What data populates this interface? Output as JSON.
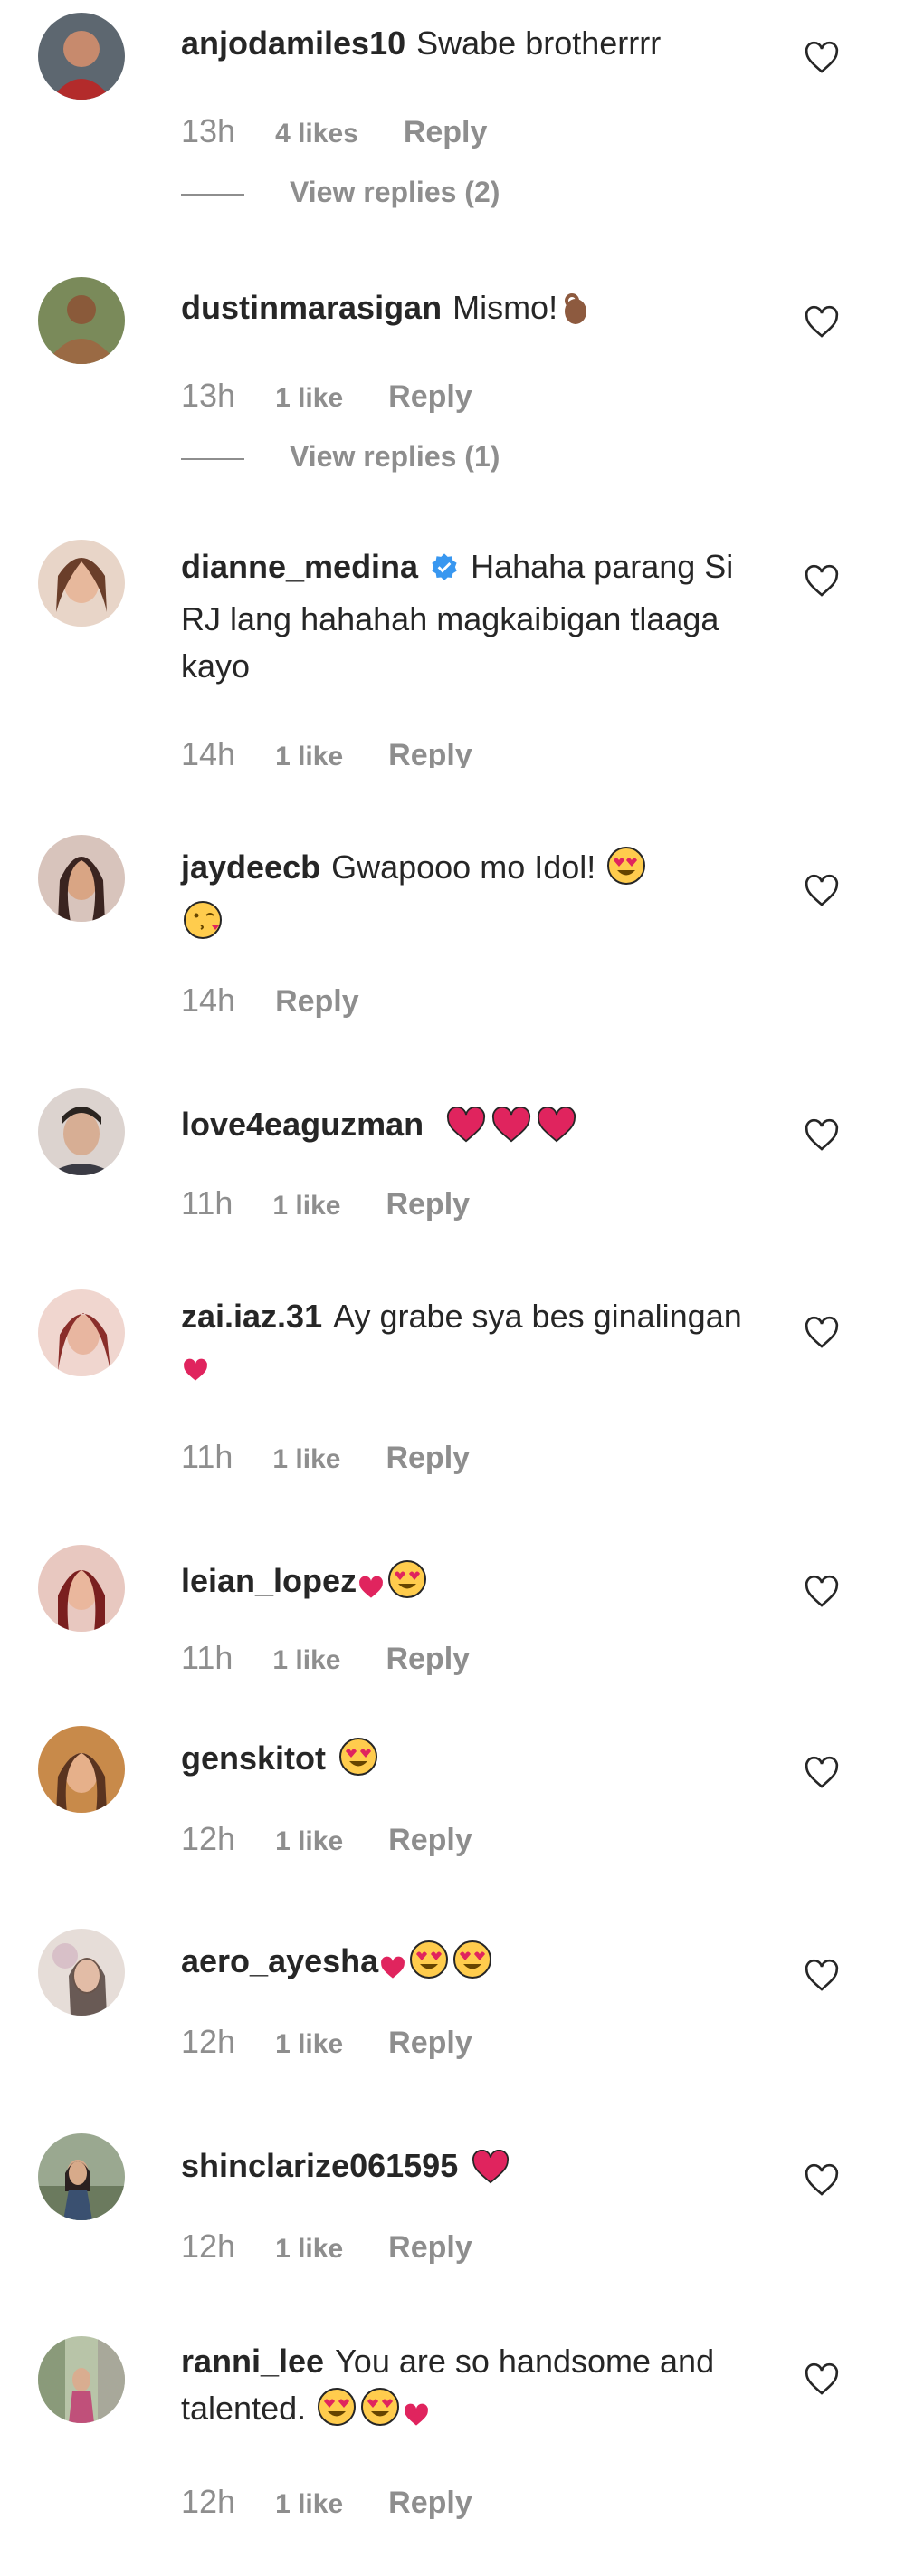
{
  "comments": [
    {
      "username": "anjodamiles10",
      "text": "Swabe brotherrrr",
      "emojis": [],
      "time": "13h",
      "likes": "4 likes",
      "reply_label": "Reply",
      "view_replies": "View replies (2)",
      "avatar_color": "#7a3b3b"
    },
    {
      "username": "dustinmarasigan",
      "text": "Mismo!",
      "emojis": [
        "ok-hand-emoji"
      ],
      "time": "13h",
      "likes": "1 like",
      "reply_label": "Reply",
      "view_replies": "View replies (1)",
      "avatar_color": "#8a6a4a"
    },
    {
      "username": "dianne_medina",
      "verified": true,
      "text": "Hahaha parang Si RJ lang hahahah magkaibigan tlaaga kayo",
      "emojis": [],
      "time": "14h",
      "likes": "1 like",
      "reply_label": "Reply",
      "avatar_color": "#d9a88f"
    },
    {
      "username": "jaydeecb",
      "text": "Gwapooo mo Idol!",
      "emojis": [
        "heart-eyes-emoji",
        "kissing-emoji"
      ],
      "time": "14h",
      "likes": "",
      "reply_label": "Reply",
      "avatar_color": "#6b4a48"
    },
    {
      "username": "love4eaguzman",
      "text": "",
      "emojis": [
        "heart-emoji",
        "heart-emoji",
        "heart-emoji"
      ],
      "time": "11h",
      "likes": "1 like",
      "reply_label": "Reply",
      "avatar_color": "#b8a096"
    },
    {
      "username": "zai.iaz.31",
      "text": "Ay grabe sya bes ginalingan",
      "emojis": [
        "small-heart-emoji"
      ],
      "time": "11h",
      "likes": "1 like",
      "reply_label": "Reply",
      "avatar_color": "#c46a6a"
    },
    {
      "username": "leian_lopez",
      "text": "",
      "emojis": [
        "small-heart-emoji",
        "heart-eyes-emoji"
      ],
      "time": "11h",
      "likes": "1 like",
      "reply_label": "Reply",
      "avatar_color": "#a6453f"
    },
    {
      "username": "genskitot",
      "text": "",
      "emojis": [
        "heart-eyes-emoji"
      ],
      "time": "12h",
      "likes": "1 like",
      "reply_label": "Reply",
      "avatar_color": "#c9955c"
    },
    {
      "username": "aero_ayesha",
      "text": "",
      "emojis": [
        "small-heart-emoji",
        "heart-eyes-emoji",
        "heart-eyes-emoji"
      ],
      "time": "12h",
      "likes": "1 like",
      "reply_label": "Reply",
      "avatar_color": "#c9bdb8"
    },
    {
      "username": "shinclarize061595",
      "text": "",
      "emojis": [
        "heart-emoji"
      ],
      "time": "12h",
      "likes": "1 like",
      "reply_label": "Reply",
      "avatar_color": "#6d8a78"
    },
    {
      "username": "ranni_lee",
      "text": "You are so handsome and talented.",
      "emojis": [
        "heart-eyes-emoji",
        "heart-eyes-emoji",
        "small-heart-emoji"
      ],
      "time": "12h",
      "likes": "1 like",
      "reply_label": "Reply",
      "avatar_color": "#8f7c70"
    }
  ],
  "colors": {
    "text": "#262626",
    "meta": "#8e8e8e",
    "verified": "#3897f0",
    "heart_red": "#e0245e",
    "emoji_yellow": "#ffcc4d"
  }
}
